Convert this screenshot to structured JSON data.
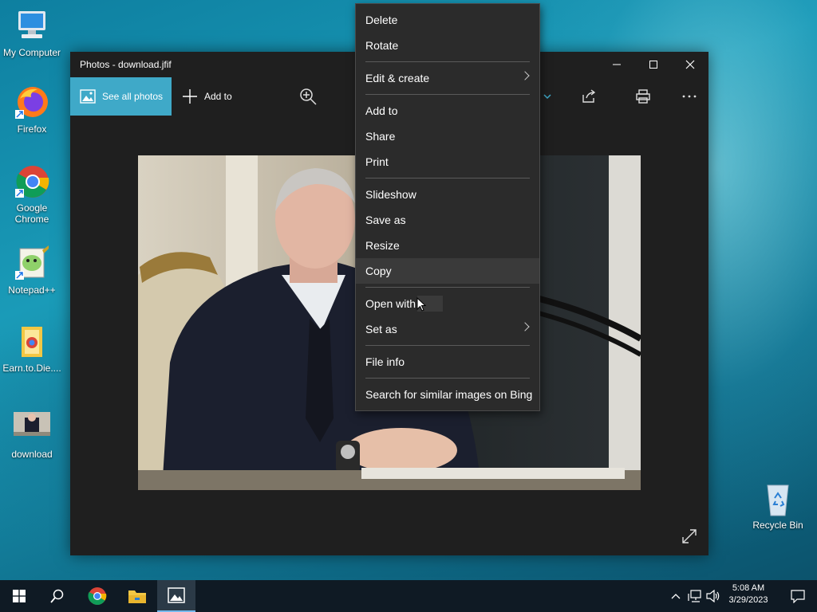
{
  "desktop": {
    "icons": [
      {
        "label": "My Computer"
      },
      {
        "label": "Firefox"
      },
      {
        "label": "Google Chrome"
      },
      {
        "label": "Notepad++"
      },
      {
        "label": "Earn.to.Die...."
      },
      {
        "label": "download"
      },
      {
        "label": "Recycle Bin"
      }
    ]
  },
  "window": {
    "title": "Photos - download.jfif",
    "see_all_label": "See all photos",
    "add_to_label": "Add to"
  },
  "context_menu": {
    "items": [
      {
        "label": "Delete"
      },
      {
        "label": "Rotate"
      },
      {
        "label": "Edit & create"
      },
      {
        "label": "Add to"
      },
      {
        "label": "Share"
      },
      {
        "label": "Print"
      },
      {
        "label": "Slideshow"
      },
      {
        "label": "Save as"
      },
      {
        "label": "Resize"
      },
      {
        "label": "Copy"
      },
      {
        "label": "Open with"
      },
      {
        "label": "Set as"
      },
      {
        "label": "File info"
      },
      {
        "label": "Search for similar images on Bing"
      }
    ]
  },
  "taskbar": {
    "time": "5:08 AM",
    "date": "3/29/2023"
  },
  "colors": {
    "accent": "#3fa9c8",
    "menu_bg": "#2b2b2b",
    "window_bg": "#1f1f1f",
    "taskbar_bg": "#0f1a24"
  }
}
